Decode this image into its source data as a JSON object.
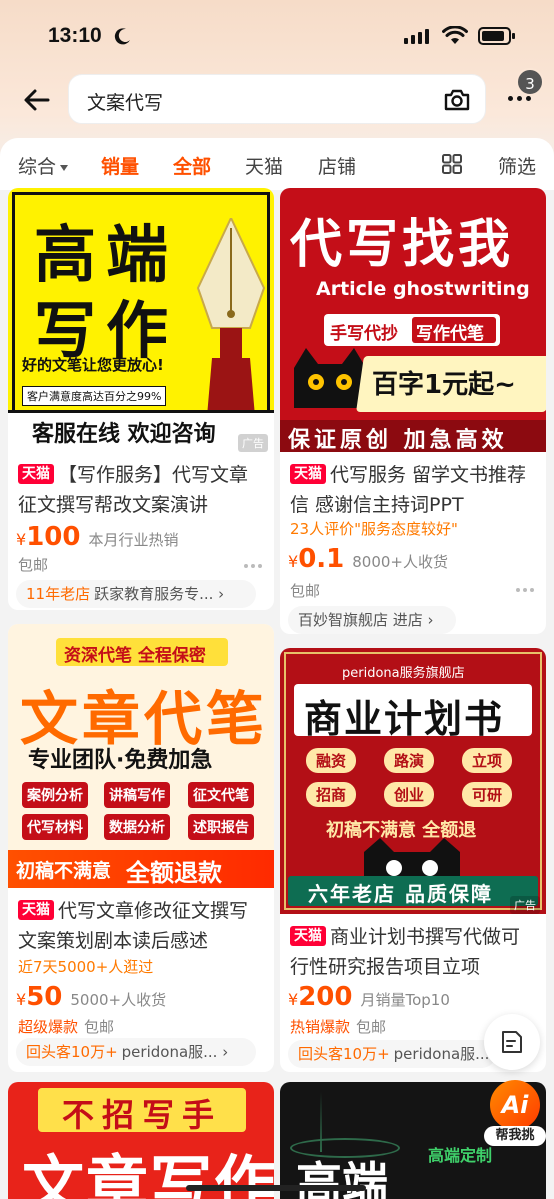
{
  "status": {
    "time": "13:10"
  },
  "search": {
    "query": "文案代写",
    "badge": "3"
  },
  "filters": {
    "items": [
      {
        "label": "综合",
        "active": false
      },
      {
        "label": "销量",
        "active": true
      },
      {
        "label": "全部",
        "active": true
      },
      {
        "label": "天猫",
        "active": false
      },
      {
        "label": "店铺",
        "active": false
      }
    ],
    "filter_label": "筛选"
  },
  "colors": {
    "accent": "#ff5000",
    "tmall": "#ff0036"
  },
  "products": [
    {
      "poster": {
        "line1": "高端",
        "line2": "写作",
        "tagline": "好的文笔让您更放心!",
        "note": "客户满意度高达百分之99%",
        "bottom": "客服在线 欢迎咨询"
      },
      "ad": "广告",
      "tmall": "天猫",
      "title": "【写作服务】代写文章征文撰写帮改文案演讲",
      "price_symbol": "¥",
      "price": "100",
      "sales": "本月行业热销",
      "shipping": "包邮",
      "shop_tag": "11年老店",
      "shop_name": "跃家教育服务专..."
    },
    {
      "poster": {
        "headline": "代写找我",
        "english": "Article ghostwriting",
        "tag1": "手写代抄",
        "tag2": "写作代笔",
        "offer": "百字1元起~",
        "bottom": "保证原创 加急高效"
      },
      "ad": "广告",
      "tmall": "天猫",
      "title": "代写服务 留学文书推荐信 感谢信主持词PPT",
      "review": "23人评价\"服务态度较好\"",
      "price_symbol": "¥",
      "price": "0.1",
      "sales": "8000+人收货",
      "shipping": "包邮",
      "shop_name": "百妙智旗舰店 进店"
    },
    {
      "poster": {
        "top": "资深代笔 全程保密",
        "headline": "文章代笔",
        "sub": "专业团队·免费加急",
        "tags": [
          "案例分析",
          "讲稿写作",
          "征文代笔",
          "代写材料",
          "数据分析",
          "述职报告"
        ],
        "bottom1": "初稿不满意",
        "bottom2": "全额退款"
      },
      "tmall": "天猫",
      "title": "代写文章修改征文撰写文案策划剧本读后感述",
      "review": "近7天5000+人逛过",
      "price_symbol": "¥",
      "price": "50",
      "sales": "5000+人收货",
      "hot": "超级爆款",
      "shipping": "包邮",
      "shop_tag": "回头客10万+",
      "shop_name": "peridona服..."
    },
    {
      "poster": {
        "store": "peridona服务旗舰店",
        "headline": "商业计划书",
        "tags": [
          "融资",
          "路演",
          "立项",
          "招商",
          "创业",
          "可研"
        ],
        "slogan": "初稿不满意 全额退",
        "bottom": "六年老店 品质保障"
      },
      "ad": "广告",
      "tmall": "天猫",
      "title": "商业计划书撰写代做可行性研究报告项目立项",
      "price_symbol": "¥",
      "price": "200",
      "sales": "月销量Top10",
      "hot": "热销爆款",
      "shipping": "包邮",
      "shop_tag": "回头客10万+",
      "shop_name": "peridona服..."
    },
    {
      "poster": {
        "top": "不招写手",
        "headline": "文章写作"
      }
    },
    {
      "poster": {
        "headline": "高端",
        "tag": "高端定制"
      }
    }
  ],
  "floating": {
    "ai_label": "帮我挑",
    "ai_text": "Ai"
  }
}
